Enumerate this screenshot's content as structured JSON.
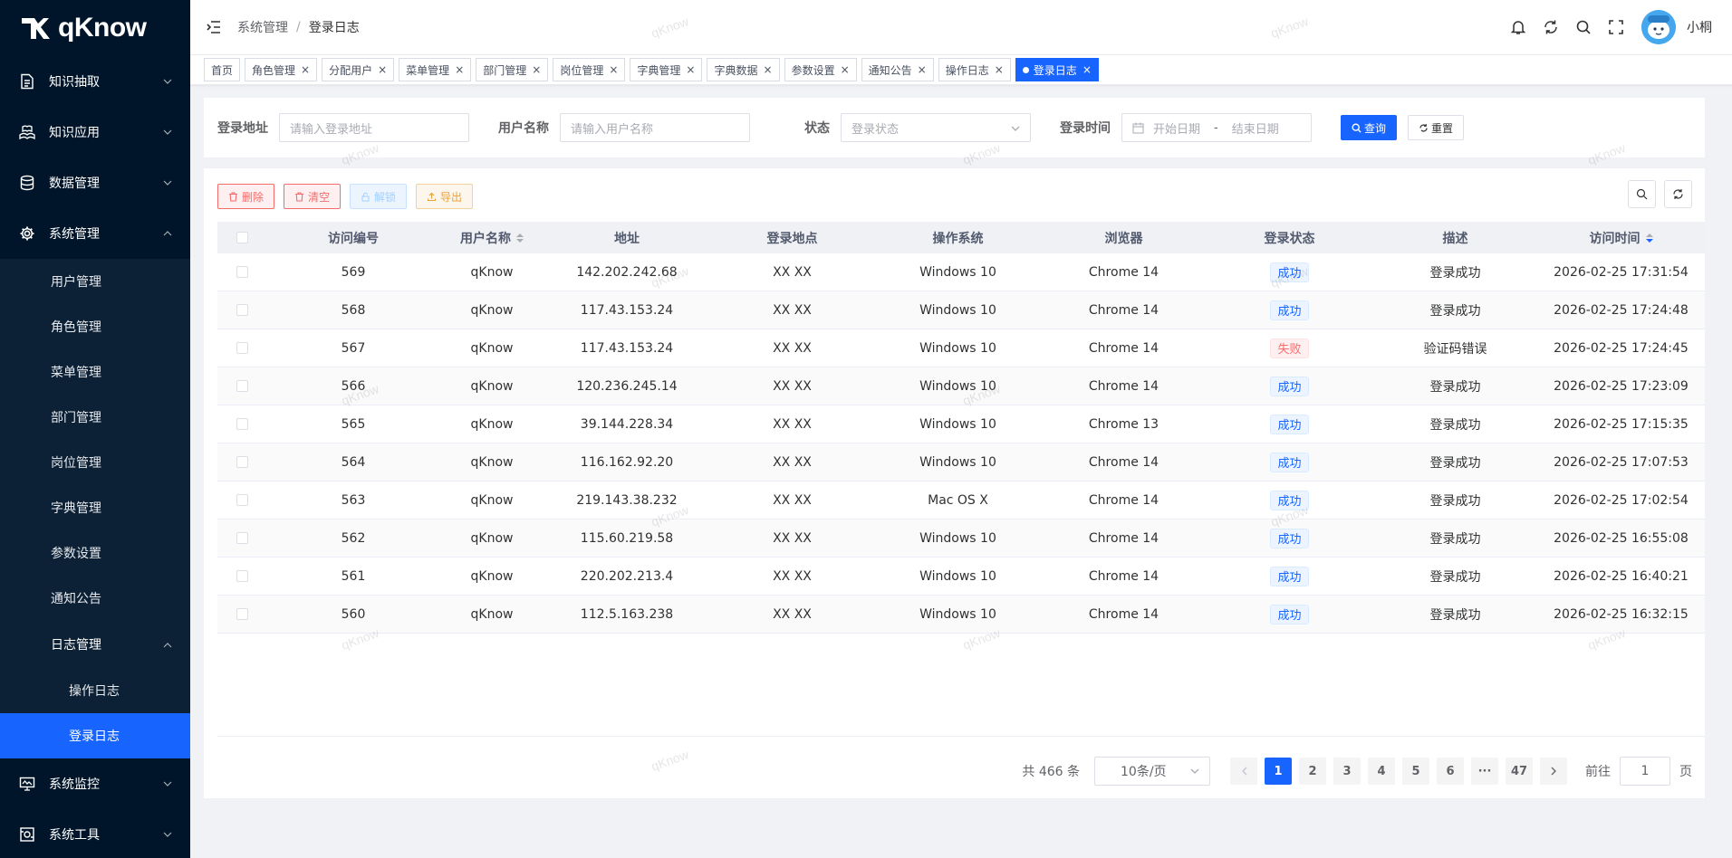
{
  "app": {
    "logo_text": "qKnow"
  },
  "sidebar": {
    "items": [
      {
        "label": "知识抽取",
        "icon": "document-icon",
        "expanded": false
      },
      {
        "label": "知识应用",
        "icon": "hand-book-icon",
        "expanded": false
      },
      {
        "label": "数据管理",
        "icon": "database-icon",
        "expanded": false
      },
      {
        "label": "系统管理",
        "icon": "gear-icon",
        "expanded": true
      },
      {
        "label": "系统监控",
        "icon": "monitor-icon",
        "expanded": false
      },
      {
        "label": "系统工具",
        "icon": "tool-icon",
        "expanded": false
      }
    ],
    "system_sub": [
      "用户管理",
      "角色管理",
      "菜单管理",
      "部门管理",
      "岗位管理",
      "字典管理",
      "参数设置",
      "通知公告"
    ],
    "log_group": "日志管理",
    "log_sub": [
      "操作日志",
      "登录日志"
    ],
    "active": "登录日志"
  },
  "header": {
    "breadcrumb": [
      "系统管理",
      "登录日志"
    ],
    "separator": "/",
    "username": "小桐"
  },
  "tags": [
    {
      "label": "首页",
      "closable": false,
      "active": false
    },
    {
      "label": "角色管理",
      "closable": true,
      "active": false
    },
    {
      "label": "分配用户",
      "closable": true,
      "active": false
    },
    {
      "label": "菜单管理",
      "closable": true,
      "active": false
    },
    {
      "label": "部门管理",
      "closable": true,
      "active": false
    },
    {
      "label": "岗位管理",
      "closable": true,
      "active": false
    },
    {
      "label": "字典管理",
      "closable": true,
      "active": false
    },
    {
      "label": "字典数据",
      "closable": true,
      "active": false
    },
    {
      "label": "参数设置",
      "closable": true,
      "active": false
    },
    {
      "label": "通知公告",
      "closable": true,
      "active": false
    },
    {
      "label": "操作日志",
      "closable": true,
      "active": false
    },
    {
      "label": "登录日志",
      "closable": true,
      "active": true
    }
  ],
  "search": {
    "address_label": "登录地址",
    "address_placeholder": "请输入登录地址",
    "username_label": "用户名称",
    "username_placeholder": "请输入用户名称",
    "status_label": "状态",
    "status_placeholder": "登录状态",
    "time_label": "登录时间",
    "start_placeholder": "开始日期",
    "range_sep": "-",
    "end_placeholder": "结束日期",
    "query_label": "查询",
    "reset_label": "重置"
  },
  "toolbar": {
    "delete_label": "删除",
    "clear_label": "清空",
    "unlock_label": "解锁",
    "export_label": "导出"
  },
  "table": {
    "columns": [
      "访问编号",
      "用户名称",
      "地址",
      "登录地点",
      "操作系统",
      "浏览器",
      "登录状态",
      "描述",
      "访问时间"
    ],
    "rows": [
      {
        "id": "569",
        "user": "qKnow",
        "ip": "142.202.242.68",
        "location": "XX XX",
        "os": "Windows 10",
        "browser": "Chrome 14",
        "status": "成功",
        "ok": true,
        "desc": "登录成功",
        "time": "2026-02-25 17:31:54"
      },
      {
        "id": "568",
        "user": "qKnow",
        "ip": "117.43.153.24",
        "location": "XX XX",
        "os": "Windows 10",
        "browser": "Chrome 14",
        "status": "成功",
        "ok": true,
        "desc": "登录成功",
        "time": "2026-02-25 17:24:48"
      },
      {
        "id": "567",
        "user": "qKnow",
        "ip": "117.43.153.24",
        "location": "XX XX",
        "os": "Windows 10",
        "browser": "Chrome 14",
        "status": "失败",
        "ok": false,
        "desc": "验证码错误",
        "time": "2026-02-25 17:24:45"
      },
      {
        "id": "566",
        "user": "qKnow",
        "ip": "120.236.245.14",
        "location": "XX XX",
        "os": "Windows 10",
        "browser": "Chrome 14",
        "status": "成功",
        "ok": true,
        "desc": "登录成功",
        "time": "2026-02-25 17:23:09"
      },
      {
        "id": "565",
        "user": "qKnow",
        "ip": "39.144.228.34",
        "location": "XX XX",
        "os": "Windows 10",
        "browser": "Chrome 13",
        "status": "成功",
        "ok": true,
        "desc": "登录成功",
        "time": "2026-02-25 17:15:35"
      },
      {
        "id": "564",
        "user": "qKnow",
        "ip": "116.162.92.20",
        "location": "XX XX",
        "os": "Windows 10",
        "browser": "Chrome 14",
        "status": "成功",
        "ok": true,
        "desc": "登录成功",
        "time": "2026-02-25 17:07:53"
      },
      {
        "id": "563",
        "user": "qKnow",
        "ip": "219.143.38.232",
        "location": "XX XX",
        "os": "Mac OS X",
        "browser": "Chrome 14",
        "status": "成功",
        "ok": true,
        "desc": "登录成功",
        "time": "2026-02-25 17:02:54"
      },
      {
        "id": "562",
        "user": "qKnow",
        "ip": "115.60.219.58",
        "location": "XX XX",
        "os": "Windows 10",
        "browser": "Chrome 14",
        "status": "成功",
        "ok": true,
        "desc": "登录成功",
        "time": "2026-02-25 16:55:08"
      },
      {
        "id": "561",
        "user": "qKnow",
        "ip": "220.202.213.4",
        "location": "XX XX",
        "os": "Windows 10",
        "browser": "Chrome 14",
        "status": "成功",
        "ok": true,
        "desc": "登录成功",
        "time": "2026-02-25 16:40:21"
      },
      {
        "id": "560",
        "user": "qKnow",
        "ip": "112.5.163.238",
        "location": "XX XX",
        "os": "Windows 10",
        "browser": "Chrome 14",
        "status": "成功",
        "ok": true,
        "desc": "登录成功",
        "time": "2026-02-25 16:32:15"
      }
    ]
  },
  "pagination": {
    "total_text": "共 466 条",
    "page_size": "10条/页",
    "pages": [
      "1",
      "2",
      "3",
      "4",
      "5",
      "6",
      "···",
      "47"
    ],
    "current": "1",
    "goto_label": "前往",
    "goto_value": "1",
    "goto_suffix": "页"
  },
  "watermark": "qKnow",
  "colors": {
    "primary": "#1764ff",
    "sidebar": "#001529",
    "danger": "#f56c6c",
    "warning": "#e6a23c"
  }
}
